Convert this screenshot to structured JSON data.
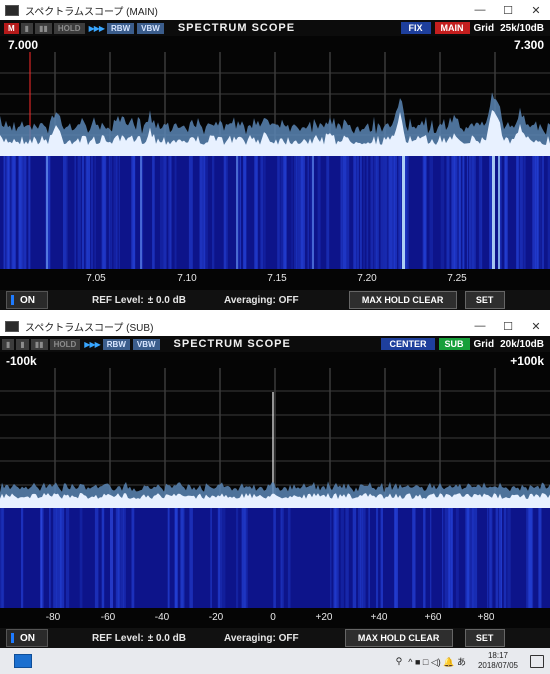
{
  "main": {
    "window_title": "スペクトラムスコープ (MAIN)",
    "toolbar": {
      "m_btn": "M",
      "btn2": "",
      "hold": "HOLD",
      "arrows": "▶▶▶",
      "rbw": "RBW",
      "vbw": "VBW",
      "title": "SPECTRUM SCOPE",
      "mode": "FIX",
      "band": "MAIN",
      "grid_label": "Grid",
      "span": "25k/10dB"
    },
    "left_freq": "7.000",
    "right_freq": "7.300",
    "axis_labels": [
      "7.05",
      "7.10",
      "7.15",
      "7.20",
      "7.25"
    ],
    "bottom": {
      "on_label": "ON",
      "ref_level_label": "REF Level:",
      "ref_level_value": "± 0.0 dB",
      "averaging": "Averaging: OFF",
      "max_hold_clear": "MAX HOLD CLEAR",
      "set": "SET"
    }
  },
  "sub": {
    "window_title": "スペクトラムスコープ (SUB)",
    "toolbar": {
      "hold": "HOLD",
      "arrows": "▶▶▶",
      "rbw": "RBW",
      "vbw": "VBW",
      "title": "SPECTRUM SCOPE",
      "mode": "CENTER",
      "band": "SUB",
      "grid_label": "Grid",
      "span": "20k/10dB"
    },
    "left_freq": "-100k",
    "right_freq": "+100k",
    "axis_labels": [
      "-80",
      "-60",
      "-40",
      "-20",
      "0",
      "+20",
      "+40",
      "+60",
      "+80"
    ],
    "bottom": {
      "on_label": "ON",
      "ref_level_label": "REF Level:",
      "ref_level_value": "± 0.0 dB",
      "averaging": "Averaging: OFF",
      "max_hold_clear": "MAX HOLD CLEAR",
      "set": "SET"
    }
  },
  "taskbar": {
    "tray_text": "^ ■ □ ◁) 🔔 あ",
    "time": "18:17",
    "date": "2018/07/05",
    "ime": "あ"
  },
  "colors": {
    "band_main": "#c41e1e",
    "band_sub": "#17a03a",
    "mode_bg": "#1e3f9c",
    "spectrum_fill": "#e8f1ff",
    "waterfall_dark": "#0d148a",
    "waterfall_mid": "#2440d4",
    "marker_red": "#ff2a2a"
  },
  "icons": {
    "window_icon": "scope-window-icon",
    "close": "close-icon",
    "minimize": "minimize-icon",
    "maximize": "maximize-icon",
    "taskbar_app": "scope-app-icon",
    "network": "network-icon",
    "volume": "volume-icon",
    "notification": "notification-icon"
  }
}
